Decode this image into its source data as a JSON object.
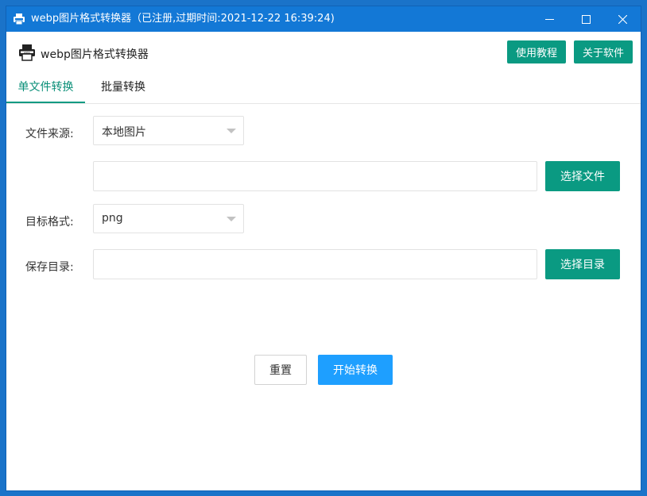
{
  "window": {
    "title": "webp图片格式转换器（已注册,过期时间:2021-12-22 16:39:24)"
  },
  "header": {
    "app_title": "webp图片格式转换器",
    "tutorial_label": "使用教程",
    "about_label": "关于软件"
  },
  "tabs": [
    {
      "label": "单文件转换",
      "active": true
    },
    {
      "label": "批量转换",
      "active": false
    }
  ],
  "form": {
    "source_label": "文件来源:",
    "source_value": "本地图片",
    "file_path_value": "",
    "choose_file_label": "选择文件",
    "format_label": "目标格式:",
    "format_value": "png",
    "save_dir_label": "保存目录:",
    "save_dir_value": "",
    "choose_dir_label": "选择目录"
  },
  "actions": {
    "reset_label": "重置",
    "start_label": "开始转换"
  },
  "colors": {
    "titlebar": "#1378d6",
    "primary_green": "#0a9a82",
    "start_blue": "#1e9fff"
  },
  "icons": {
    "app": "webp-printer-icon",
    "minimize": "minimize-icon",
    "maximize": "maximize-icon",
    "close": "close-icon"
  }
}
